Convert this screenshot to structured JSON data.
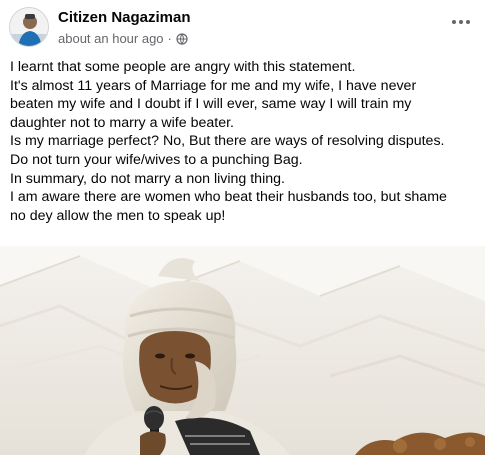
{
  "post": {
    "author": "Citizen Nagaziman",
    "timestamp": "about an hour ago",
    "separator": "·",
    "privacy_icon": "globe-icon",
    "more_icon": "more-options-icon",
    "lines": [
      "I learnt that some people are angry with this statement.",
      "It's almost 11 years of Marriage for me and my wife, I have never",
      "beaten my wife and I doubt if I will ever, same way I will train my",
      "daughter not to marry a wife beater.",
      "Is my marriage perfect? No,  But there are ways of resolving disputes.",
      "Do not turn your wife/wives to a punching Bag.",
      "In summary, do not marry a non living thing.",
      "I am aware there are women who beat their husbands too, but shame",
      "no dey allow the men to speak up!"
    ]
  },
  "colors": {
    "text_primary": "#050505",
    "text_secondary": "#65676b",
    "background": "#ffffff"
  }
}
